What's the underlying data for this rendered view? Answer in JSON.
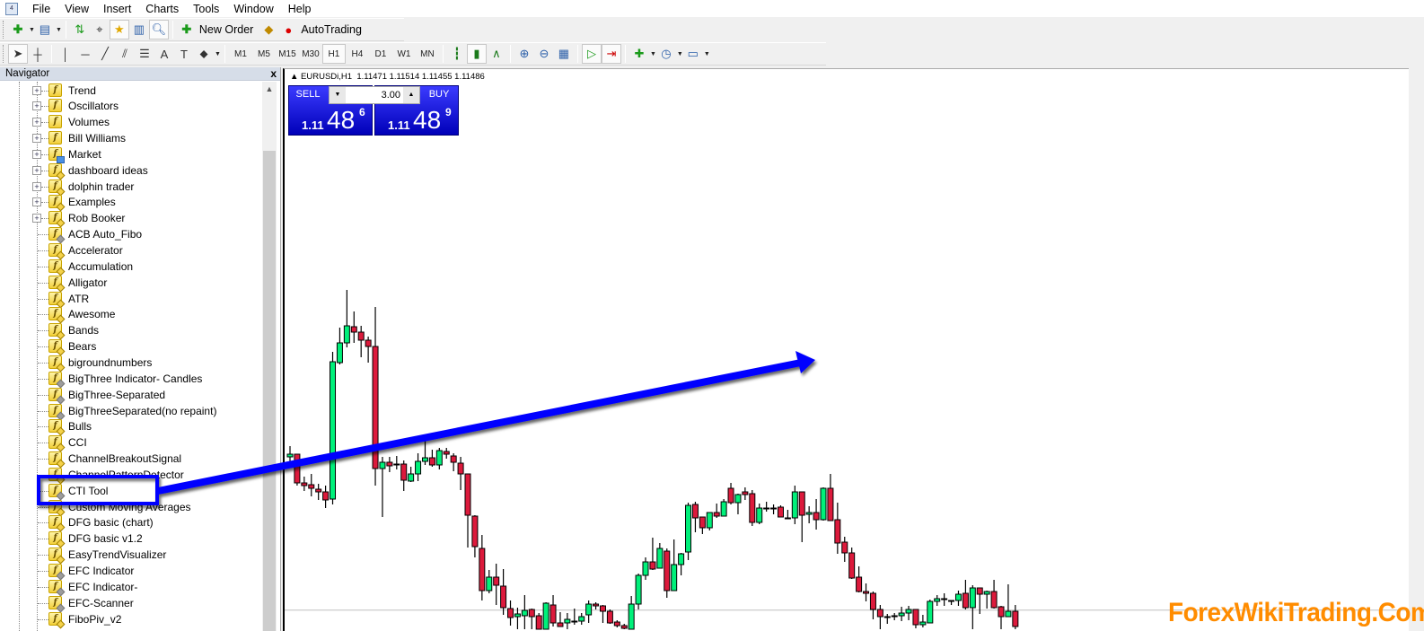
{
  "menu": [
    "File",
    "View",
    "Insert",
    "Charts",
    "Tools",
    "Window",
    "Help"
  ],
  "toolbar": {
    "new_order_label": "New Order",
    "autotrading_label": "AutoTrading",
    "timeframes": [
      "M1",
      "M5",
      "M15",
      "M30",
      "H1",
      "H4",
      "D1",
      "W1",
      "MN"
    ],
    "active_timeframe": "H1"
  },
  "navigator": {
    "title": "Navigator",
    "close": "x",
    "items": [
      {
        "label": "Trend",
        "type": "folder",
        "icon": "indicator-folder-icon"
      },
      {
        "label": "Oscillators",
        "type": "folder",
        "icon": "indicator-folder-icon"
      },
      {
        "label": "Volumes",
        "type": "folder",
        "icon": "indicator-folder-icon"
      },
      {
        "label": "Bill Williams",
        "type": "folder",
        "icon": "indicator-folder-icon"
      },
      {
        "label": "Market",
        "type": "folder",
        "icon": "market-folder-icon"
      },
      {
        "label": "dashboard ideas",
        "type": "folder",
        "icon": "custom-indicator-folder-icon"
      },
      {
        "label": "dolphin trader",
        "type": "folder",
        "icon": "custom-indicator-folder-icon"
      },
      {
        "label": "Examples",
        "type": "folder",
        "icon": "custom-indicator-folder-icon"
      },
      {
        "label": "Rob Booker",
        "type": "folder",
        "icon": "custom-indicator-folder-icon"
      },
      {
        "label": "ACB Auto_Fibo",
        "type": "leaf",
        "icon": "compiled-indicator-icon"
      },
      {
        "label": "Accelerator",
        "type": "leaf",
        "icon": "custom-indicator-icon"
      },
      {
        "label": "Accumulation",
        "type": "leaf",
        "icon": "custom-indicator-icon"
      },
      {
        "label": "Alligator",
        "type": "leaf",
        "icon": "custom-indicator-icon"
      },
      {
        "label": "ATR",
        "type": "leaf",
        "icon": "custom-indicator-icon"
      },
      {
        "label": "Awesome",
        "type": "leaf",
        "icon": "custom-indicator-icon"
      },
      {
        "label": "Bands",
        "type": "leaf",
        "icon": "custom-indicator-icon"
      },
      {
        "label": "Bears",
        "type": "leaf",
        "icon": "custom-indicator-icon"
      },
      {
        "label": "bigroundnumbers",
        "type": "leaf",
        "icon": "custom-indicator-icon"
      },
      {
        "label": "BigThree Indicator- Candles",
        "type": "leaf",
        "icon": "compiled-indicator-icon"
      },
      {
        "label": "BigThree-Separated",
        "type": "leaf",
        "icon": "compiled-indicator-icon"
      },
      {
        "label": "BigThreeSeparated(no repaint)",
        "type": "leaf",
        "icon": "compiled-indicator-icon"
      },
      {
        "label": "Bulls",
        "type": "leaf",
        "icon": "custom-indicator-icon"
      },
      {
        "label": "CCI",
        "type": "leaf",
        "icon": "custom-indicator-icon"
      },
      {
        "label": "ChannelBreakoutSignal",
        "type": "leaf",
        "icon": "custom-indicator-icon"
      },
      {
        "label": "ChannelPatternDetector",
        "type": "leaf",
        "icon": "custom-indicator-icon"
      },
      {
        "label": "CTI Tool",
        "type": "leaf",
        "icon": "compiled-indicator-icon",
        "highlighted": true
      },
      {
        "label": "Custom Moving Averages",
        "type": "leaf",
        "icon": "custom-indicator-icon"
      },
      {
        "label": "DFG basic (chart)",
        "type": "leaf",
        "icon": "custom-indicator-icon"
      },
      {
        "label": "DFG basic v1.2",
        "type": "leaf",
        "icon": "custom-indicator-icon"
      },
      {
        "label": "EasyTrendVisualizer",
        "type": "leaf",
        "icon": "custom-indicator-icon"
      },
      {
        "label": "EFC Indicator",
        "type": "leaf",
        "icon": "compiled-indicator-icon"
      },
      {
        "label": "EFC Indicator-",
        "type": "leaf",
        "icon": "compiled-indicator-icon"
      },
      {
        "label": "EFC-Scanner",
        "type": "leaf",
        "icon": "compiled-indicator-icon"
      },
      {
        "label": "FiboPiv_v2",
        "type": "leaf",
        "icon": "custom-indicator-icon"
      }
    ]
  },
  "chart": {
    "symbol": "EURUSDi,H1",
    "ohlc": "1.11471 1.11514 1.11455 1.11486",
    "sell_label": "SELL",
    "buy_label": "BUY",
    "lot": "3.00",
    "sell_price": {
      "prefix": "1.11",
      "big": "48",
      "sup": "6"
    },
    "buy_price": {
      "prefix": "1.11",
      "big": "48",
      "sup": "9"
    },
    "bid_line": 1.11486,
    "colors": {
      "bull": "#00f07a",
      "bear": "#dc1a3c",
      "annotation": "#0000ff",
      "watermark": "#ff8c00"
    }
  },
  "chart_data": {
    "type": "candlestick",
    "ohlc_order": [
      "open",
      "high",
      "low",
      "close"
    ],
    "candles": [
      [
        1.1234,
        1.124,
        1.1228,
        1.12355
      ],
      [
        1.12355,
        1.12355,
        1.1218,
        1.12195
      ],
      [
        1.12195,
        1.1223,
        1.1215,
        1.1218
      ],
      [
        1.12185,
        1.12245,
        1.1212,
        1.12165
      ],
      [
        1.1216,
        1.1219,
        1.121,
        1.12145
      ],
      [
        1.12145,
        1.1218,
        1.12055,
        1.121
      ],
      [
        1.12105,
        1.12925,
        1.12075,
        1.1287
      ],
      [
        1.12865,
        1.1306,
        1.12855,
        1.12975
      ],
      [
        1.12975,
        1.1327,
        1.1295,
        1.1307
      ],
      [
        1.13065,
        1.1315,
        1.12975,
        1.13035
      ],
      [
        1.13035,
        1.1307,
        1.12895,
        1.1299
      ],
      [
        1.1299,
        1.1301,
        1.12865,
        1.12955
      ],
      [
        1.12955,
        1.13175,
        1.1218,
        1.12275
      ],
      [
        1.12275,
        1.1234,
        1.12005,
        1.1231
      ],
      [
        1.1231,
        1.1234,
        1.12255,
        1.1229
      ],
      [
        1.123,
        1.12345,
        1.1227,
        1.123
      ],
      [
        1.123,
        1.1232,
        1.1215,
        1.1221
      ],
      [
        1.12205,
        1.12285,
        1.122,
        1.12245
      ],
      [
        1.12245,
        1.1236,
        1.12205,
        1.12315
      ],
      [
        1.12315,
        1.1244,
        1.12295,
        1.12335
      ],
      [
        1.12335,
        1.1238,
        1.12285,
        1.12295
      ],
      [
        1.12295,
        1.1239,
        1.1227,
        1.12375
      ],
      [
        1.1237,
        1.1239,
        1.1233,
        1.12355
      ],
      [
        1.12345,
        1.1236,
        1.1226,
        1.1231
      ],
      [
        1.12305,
        1.1234,
        1.12155,
        1.12245
      ],
      [
        1.12245,
        1.12245,
        1.11835,
        1.12015
      ],
      [
        1.1201,
        1.12015,
        1.1178,
        1.1184
      ],
      [
        1.1183,
        1.11905,
        1.1154,
        1.11595
      ],
      [
        1.11595,
        1.1171,
        1.1158,
        1.1167
      ],
      [
        1.1167,
        1.11745,
        1.11515,
        1.11625
      ],
      [
        1.1162,
        1.11715,
        1.1146,
        1.115
      ],
      [
        1.11495,
        1.1154,
        1.114,
        1.11445
      ],
      [
        1.1145,
        1.115,
        1.1138,
        1.11465
      ],
      [
        1.11455,
        1.1157,
        1.1138,
        1.11485
      ],
      [
        1.1149,
        1.11495,
        1.1138,
        1.1145
      ],
      [
        1.11455,
        1.1147,
        1.1138,
        1.1138
      ],
      [
        1.1138,
        1.1153,
        1.1138,
        1.11525
      ],
      [
        1.11515,
        1.1157,
        1.11395,
        1.11415
      ],
      [
        1.11415,
        1.11475,
        1.11395,
        1.11395
      ],
      [
        1.11415,
        1.1147,
        1.1138,
        1.11435
      ],
      [
        1.11425,
        1.11495,
        1.11405,
        1.11425
      ],
      [
        1.11425,
        1.1147,
        1.11405,
        1.1145
      ],
      [
        1.1146,
        1.1154,
        1.11415,
        1.1152
      ],
      [
        1.1152,
        1.1153,
        1.1149,
        1.1151
      ],
      [
        1.1151,
        1.11515,
        1.11415,
        1.1148
      ],
      [
        1.1148,
        1.1149,
        1.1141,
        1.11415
      ],
      [
        1.1142,
        1.1143,
        1.1139,
        1.114
      ],
      [
        1.114,
        1.1141,
        1.1138,
        1.11385
      ],
      [
        1.1138,
        1.11565,
        1.1138,
        1.1152
      ],
      [
        1.1152,
        1.1169,
        1.1149,
        1.1168
      ],
      [
        1.1168,
        1.1178,
        1.11655,
        1.11755
      ],
      [
        1.11755,
        1.1189,
        1.1171,
        1.11715
      ],
      [
        1.1172,
        1.1186,
        1.1172,
        1.1183
      ],
      [
        1.11815,
        1.1183,
        1.11555,
        1.11595
      ],
      [
        1.11595,
        1.1188,
        1.11595,
        1.1174
      ],
      [
        1.1174,
        1.11805,
        1.1168,
        1.118
      ],
      [
        1.1181,
        1.12085,
        1.11765,
        1.1207
      ],
      [
        1.12075,
        1.1209,
        1.1192,
        1.12
      ],
      [
        1.12005,
        1.12005,
        1.1191,
        1.11945
      ],
      [
        1.11945,
        1.11945,
        1.1193,
        1.1203
      ],
      [
        1.1203,
        1.1208,
        1.12,
        1.1201
      ],
      [
        1.1201,
        1.12105,
        1.1201,
        1.1209
      ],
      [
        1.12165,
        1.12195,
        1.12075,
        1.12085
      ],
      [
        1.12085,
        1.12135,
        1.1202,
        1.1213
      ],
      [
        1.12145,
        1.1217,
        1.121,
        1.1213
      ],
      [
        1.12135,
        1.12155,
        1.11955,
        1.11975
      ],
      [
        1.11975,
        1.1208,
        1.11965,
        1.12055
      ],
      [
        1.12055,
        1.1209,
        1.12035,
        1.12055
      ],
      [
        1.12055,
        1.12075,
        1.1202,
        1.12055
      ],
      [
        1.1206,
        1.1207,
        1.12005,
        1.12005
      ],
      [
        1.12,
        1.12045,
        1.12,
        1.12
      ],
      [
        1.12,
        1.1218,
        1.11965,
        1.12145
      ],
      [
        1.12145,
        1.12145,
        1.11865,
        1.12015
      ],
      [
        1.1202,
        1.12065,
        1.1197,
        1.1203
      ],
      [
        1.1203,
        1.12105,
        1.11935,
        1.1199
      ],
      [
        1.1199,
        1.1217,
        1.11985,
        1.12165
      ],
      [
        1.12165,
        1.12245,
        1.11985,
        1.11985
      ],
      [
        1.1199,
        1.12085,
        1.118,
        1.1186
      ],
      [
        1.11865,
        1.11895,
        1.11755,
        1.11805
      ],
      [
        1.11805,
        1.11835,
        1.1166,
        1.11665
      ],
      [
        1.1167,
        1.1173,
        1.11585,
        1.1159
      ],
      [
        1.1159,
        1.11635,
        1.11535,
        1.1158
      ],
      [
        1.1158,
        1.1159,
        1.11435,
        1.1149
      ],
      [
        1.1149,
        1.11515,
        1.1138,
        1.1145
      ],
      [
        1.1145,
        1.11465,
        1.1141,
        1.1145
      ],
      [
        1.11455,
        1.1147,
        1.1143,
        1.11455
      ],
      [
        1.11455,
        1.11505,
        1.11425,
        1.1147
      ],
      [
        1.1147,
        1.1151,
        1.1143,
        1.1149
      ],
      [
        1.1149,
        1.1149,
        1.11385,
        1.11405
      ],
      [
        1.11405,
        1.1146,
        1.1139,
        1.1142
      ],
      [
        1.11415,
        1.11545,
        1.11415,
        1.11535
      ],
      [
        1.11535,
        1.1157,
        1.1151,
        1.1155
      ],
      [
        1.1155,
        1.1158,
        1.1151,
        1.1155
      ],
      [
        1.1154,
        1.1154,
        1.11515,
        1.1154
      ],
      [
        1.1154,
        1.11595,
        1.1151,
        1.11575
      ],
      [
        1.1158,
        1.11655,
        1.1149,
        1.115
      ],
      [
        1.115,
        1.11625,
        1.1138,
        1.1161
      ],
      [
        1.1161,
        1.1161,
        1.11465,
        1.11575
      ],
      [
        1.11575,
        1.11595,
        1.11495,
        1.1159
      ],
      [
        1.1159,
        1.11655,
        1.11495,
        1.115
      ],
      [
        1.11505,
        1.1151,
        1.1138,
        1.1145
      ],
      [
        1.1145,
        1.1163,
        1.1145,
        1.1148
      ],
      [
        1.1148,
        1.11515,
        1.1138,
        1.11395
      ]
    ],
    "grid": false,
    "title": "",
    "xlabel": "",
    "ylabel": ""
  },
  "watermark": "ForexWikiTrading.Com"
}
